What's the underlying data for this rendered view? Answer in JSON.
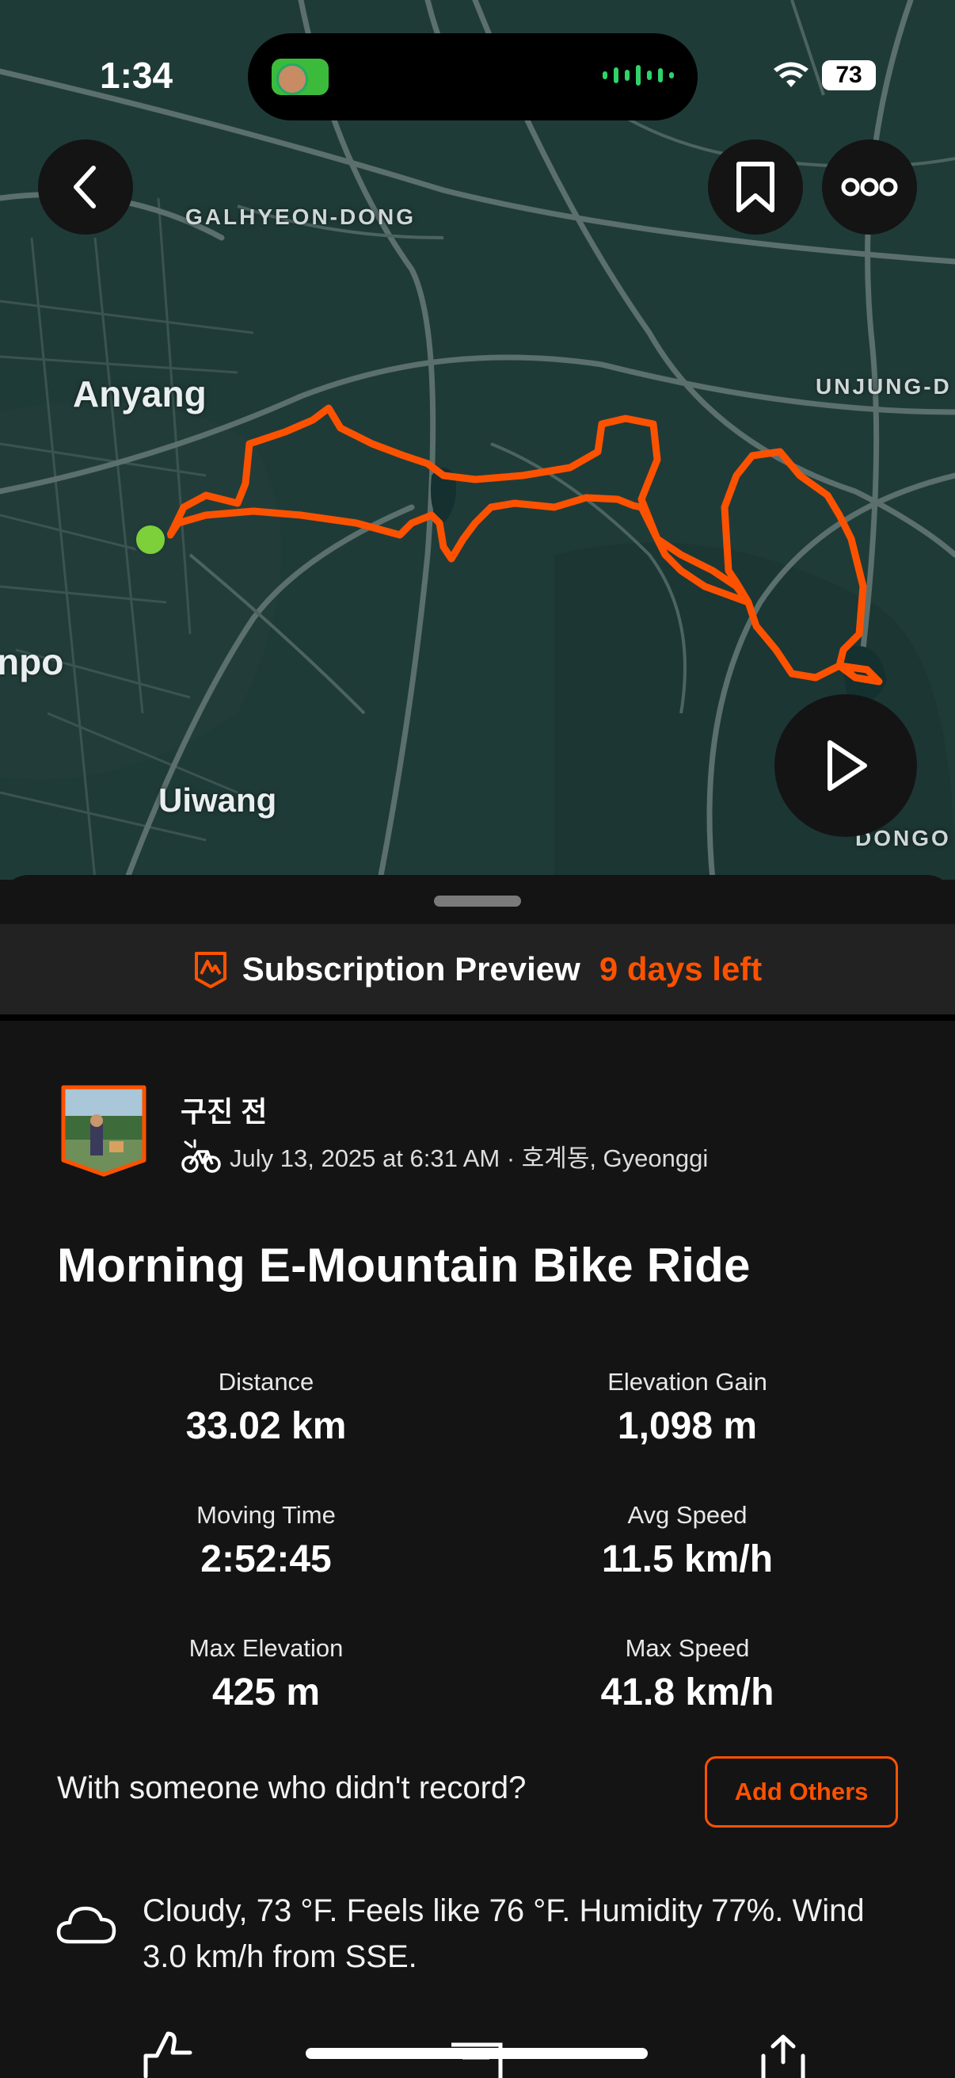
{
  "status_bar": {
    "time": "1:34",
    "battery": "73"
  },
  "map": {
    "labels": {
      "galhyeon": "GALHYEON-DONG",
      "anyang": "Anyang",
      "unjung": "UNJUNG-D",
      "gunpo": "npo",
      "uiwang": "Uiwang",
      "dongo": "DONGO"
    },
    "route_color": "#fc5200",
    "start_marker_color": "#7ed03a"
  },
  "subscription": {
    "title": "Subscription Preview",
    "days_left": "9 days left"
  },
  "activity": {
    "athlete_name": "구진 전",
    "meta": "July 13, 2025 at 6:31 AM · 호계동, Gyeonggi",
    "title": "Morning E-Mountain Bike Ride",
    "stats": {
      "distance": {
        "label": "Distance",
        "value": "33.02 km"
      },
      "elevation_gain": {
        "label": "Elevation Gain",
        "value": "1,098 m"
      },
      "moving_time": {
        "label": "Moving Time",
        "value": "2:52:45"
      },
      "avg_speed": {
        "label": "Avg Speed",
        "value": "11.5 km/h"
      },
      "max_elevation": {
        "label": "Max Elevation",
        "value": "425 m"
      },
      "max_speed": {
        "label": "Max Speed",
        "value": "41.8 km/h"
      }
    },
    "with_others_prompt": "With someone who didn't record?",
    "add_others_label": "Add Others",
    "weather": "Cloudy, 73 °F. Feels like 76 °F. Humidity 77%. Wind 3.0 km/h from SSE."
  },
  "colors": {
    "accent": "#fc5200",
    "background": "#141414",
    "banner": "#222222"
  }
}
